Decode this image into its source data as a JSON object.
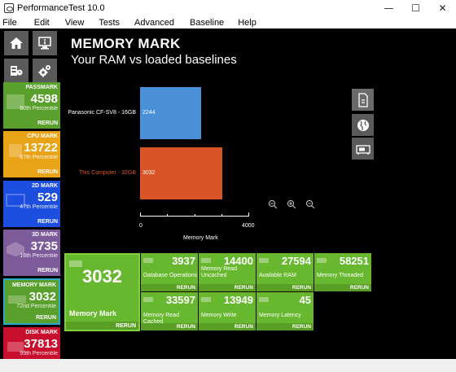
{
  "window": {
    "title": "PerformanceTest 10.0",
    "controls": [
      "—",
      "☐",
      "✕"
    ]
  },
  "menu": [
    "File",
    "Edit",
    "View",
    "Tests",
    "Advanced",
    "Baseline",
    "Help"
  ],
  "nav_icons": [
    "home-icon",
    "system-info-icon",
    "cpu-status-icon",
    "settings-gears-icon"
  ],
  "sidebar_marks": [
    {
      "label": "PASSMARK",
      "value": "4598",
      "percentile": "60th Percentile",
      "rerun": "RERUN",
      "color": "#5aa02c"
    },
    {
      "label": "CPU MARK",
      "value": "13722",
      "percentile": "67th Percentile",
      "rerun": "RERUN",
      "color": "#e8a316"
    },
    {
      "label": "2D MARK",
      "value": "529",
      "percentile": "47th Percentile",
      "rerun": "RERUN",
      "color": "#1c4ee0"
    },
    {
      "label": "3D MARK",
      "value": "3735",
      "percentile": "16th Percentile",
      "rerun": "RERUN",
      "color": "#7d5a9a"
    },
    {
      "label": "MEMORY MARK",
      "value": "3032",
      "percentile": "72nd Percentile",
      "rerun": "RERUN",
      "color": "#5aa02c"
    },
    {
      "label": "DISK MARK",
      "value": "37813",
      "percentile": "99th Percentile",
      "rerun": "RERUN",
      "color": "#c8102e"
    }
  ],
  "heading": "MEMORY MARK",
  "subheading": "Your RAM vs loaded baselines",
  "chart_data": {
    "type": "bar",
    "orientation": "horizontal",
    "categories": [
      "Panasonic CF-SV8 - 16GB",
      "This Computer - 32GB"
    ],
    "values": [
      2244,
      3032
    ],
    "value_labels": [
      "2244",
      "3032"
    ],
    "colors": [
      "#4a90d9",
      "#d95424"
    ],
    "label_colors": [
      "#ffffff",
      "#d95424"
    ],
    "xlim": [
      0,
      4000
    ],
    "tick_labels": [
      "0",
      "4000"
    ],
    "minor_ticks": [
      1000,
      2000,
      3000
    ],
    "xlabel": "Memory Mark"
  },
  "zoom_icons": [
    "zoom-out-icon",
    "zoom-in-icon",
    "zoom-reset-icon"
  ],
  "side_actions": [
    "export-document-icon",
    "web-globe-icon",
    "baseline-card-icon"
  ],
  "result_main": {
    "value": "3032",
    "label": "Memory Mark",
    "rerun": "RERUN"
  },
  "result_tiles": [
    {
      "value": "3937",
      "label": "Database Operations",
      "rerun": "RERUN"
    },
    {
      "value": "14400",
      "label": "Memory Read Uncached",
      "rerun": "RERUN"
    },
    {
      "value": "27594",
      "label": "Available RAM",
      "rerun": "RERUN"
    },
    {
      "value": "58251",
      "label": "Memory Threaded",
      "rerun": "RERUN"
    },
    {
      "value": "33597",
      "label": "Memory Read Cached",
      "rerun": "RERUN"
    },
    {
      "value": "13949",
      "label": "Memory Write",
      "rerun": "RERUN"
    },
    {
      "value": "45",
      "label": "Memory Latency",
      "rerun": "RERUN"
    }
  ]
}
